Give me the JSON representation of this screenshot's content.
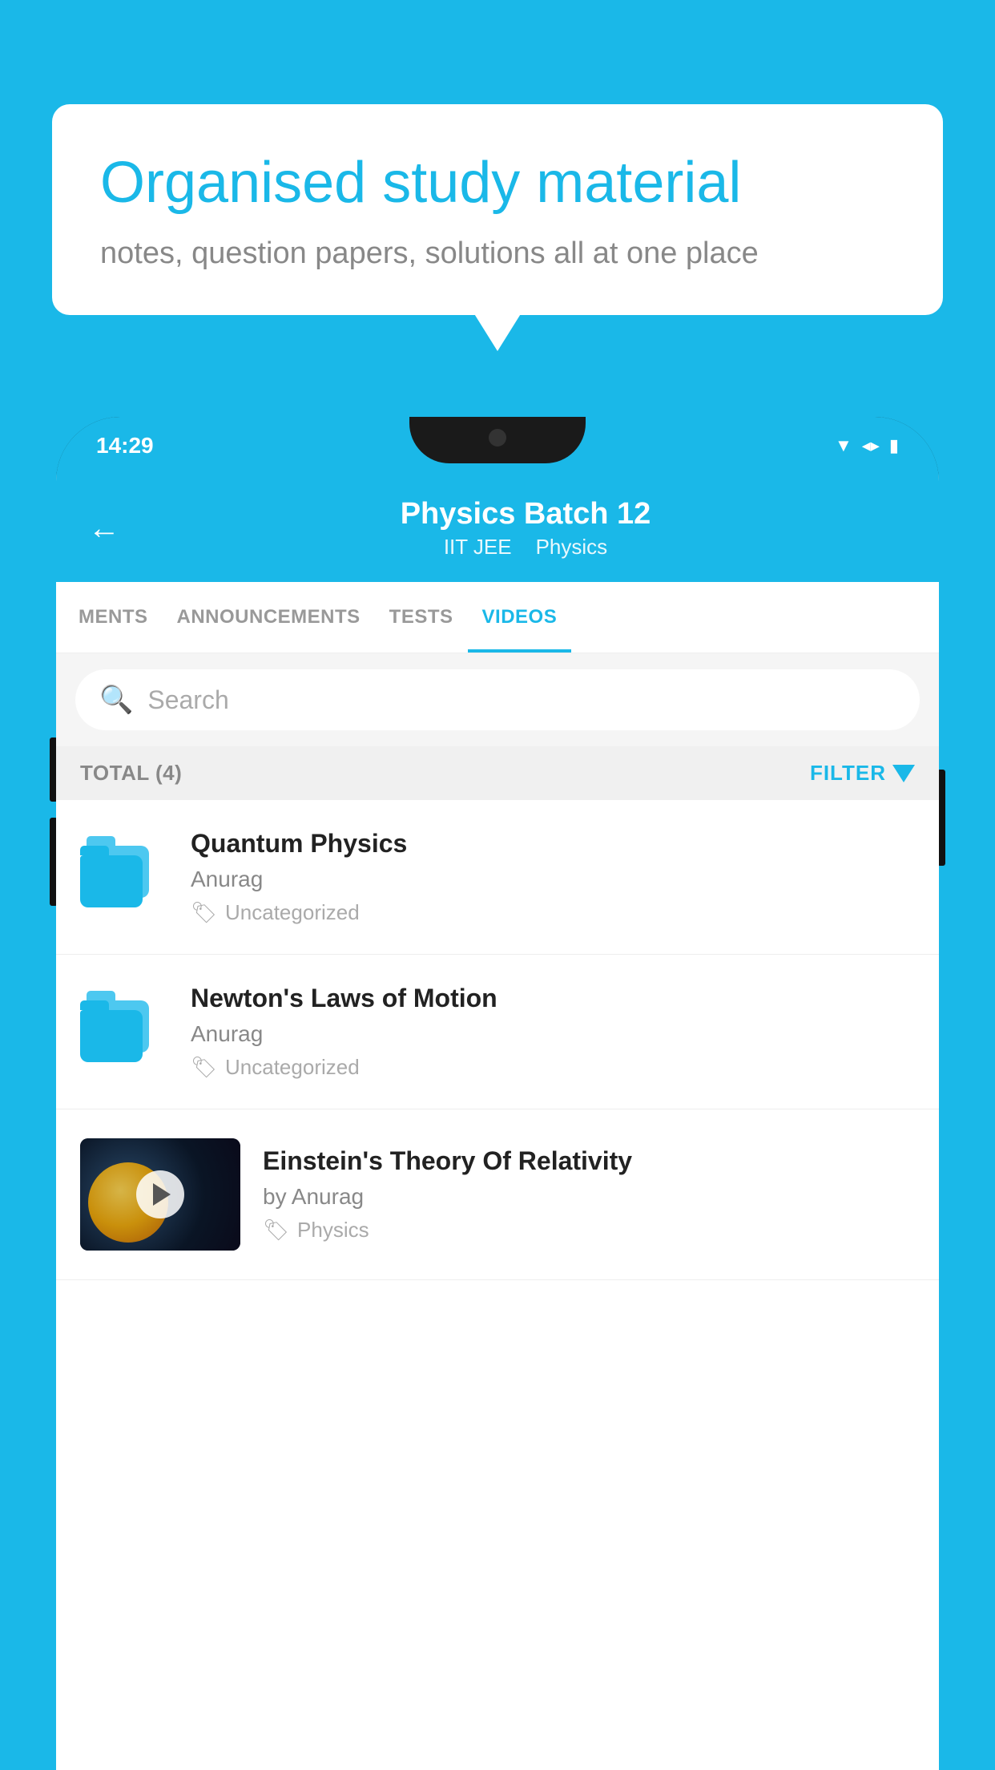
{
  "background": {
    "color": "#1ab8e8"
  },
  "speech_bubble": {
    "heading": "Organised study material",
    "subtext": "notes, question papers, solutions all at one place"
  },
  "phone": {
    "status_bar": {
      "time": "14:29",
      "icons": [
        "wifi",
        "signal",
        "battery"
      ]
    },
    "app_header": {
      "back_label": "←",
      "title": "Physics Batch 12",
      "subtitle_tags": [
        "IIT JEE",
        "Physics"
      ]
    },
    "tabs": [
      {
        "label": "MENTS",
        "active": false
      },
      {
        "label": "ANNOUNCEMENTS",
        "active": false
      },
      {
        "label": "TESTS",
        "active": false
      },
      {
        "label": "VIDEOS",
        "active": true
      }
    ],
    "search": {
      "placeholder": "Search"
    },
    "filter_bar": {
      "total_label": "TOTAL (4)",
      "filter_label": "FILTER"
    },
    "videos": [
      {
        "title": "Quantum Physics",
        "author": "Anurag",
        "tag": "Uncategorized",
        "type": "folder"
      },
      {
        "title": "Newton's Laws of Motion",
        "author": "Anurag",
        "tag": "Uncategorized",
        "type": "folder"
      },
      {
        "title": "Einstein's Theory Of Relativity",
        "author": "by Anurag",
        "tag": "Physics",
        "type": "video"
      }
    ]
  }
}
